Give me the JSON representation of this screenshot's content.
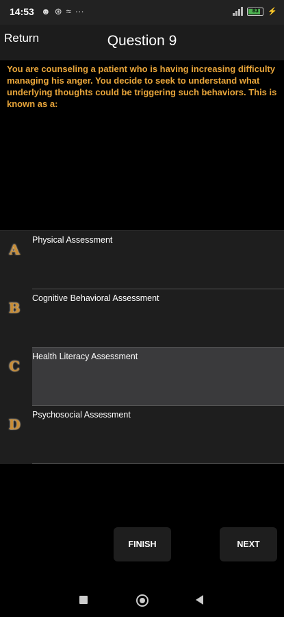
{
  "status_bar": {
    "time": "14:53",
    "icons": [
      "notification-icon",
      "settings-icon",
      "data-saver-icon",
      "more-icon"
    ],
    "battery_level": "83"
  },
  "header": {
    "return_label": "Return",
    "title": "Question 9"
  },
  "question": {
    "text": "You are counseling a patient who is having increasing difficulty managing his anger. You decide to seek to understand what underlying thoughts could be triggering such behaviors. This is known as a:"
  },
  "answers": [
    {
      "letter": "A",
      "text": "Physical Assessment",
      "selected": false
    },
    {
      "letter": "B",
      "text": "Cognitive Behavioral Assessment",
      "selected": false
    },
    {
      "letter": "C",
      "text": "Health Literacy Assessment",
      "selected": true
    },
    {
      "letter": "D",
      "text": "Psychosocial Assessment",
      "selected": false
    }
  ],
  "buttons": {
    "finish": "FINISH",
    "next": "NEXT"
  },
  "colors": {
    "accent": "#e8a53a",
    "selected_bg": "#3a3a3c"
  }
}
